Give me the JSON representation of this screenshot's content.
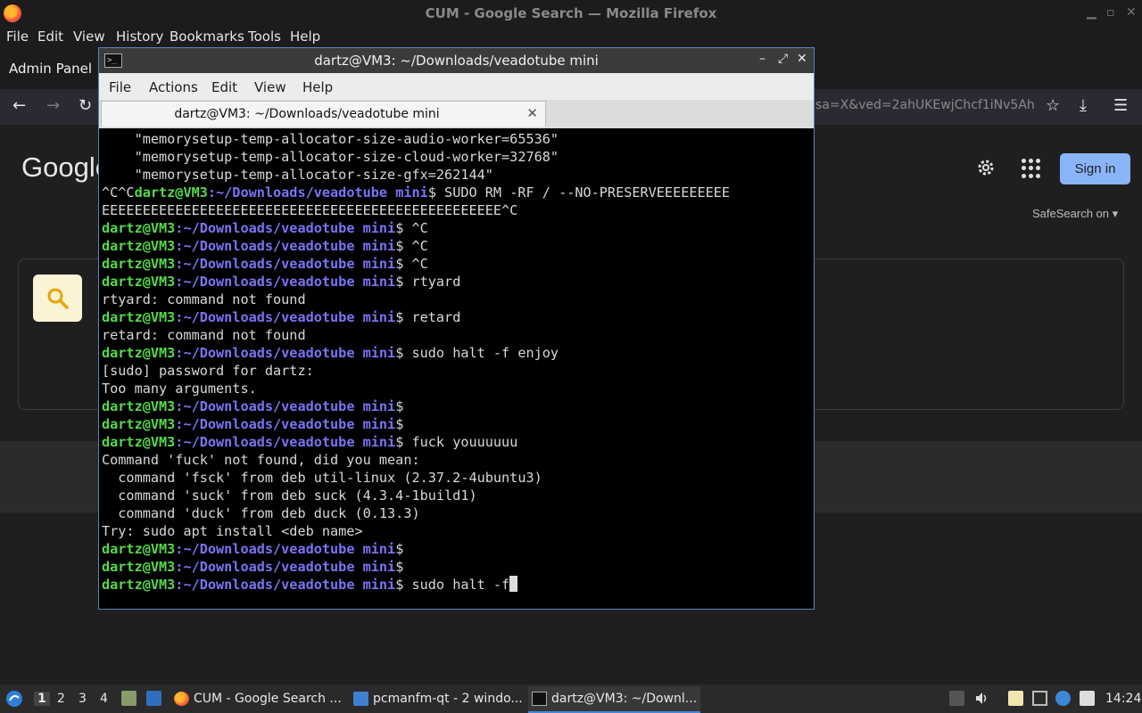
{
  "firefox": {
    "window_title": "CUM - Google Search — Mozilla Firefox",
    "menu": [
      "File",
      "Edit",
      "View",
      "History",
      "Bookmarks",
      "Tools",
      "Help"
    ],
    "bookmark_label": "Admin Panel",
    "url_fragment": "sa=X&ved=2ahUKEwjChcf1iNv5Ah"
  },
  "google": {
    "logo": "Google",
    "sign_in": "Sign in",
    "safesearch": "SafeSearch on ▾",
    "accent": "#8ab4f8"
  },
  "terminal": {
    "title": "dartz@VM3: ~/Downloads/veadotube mini",
    "menu": [
      "File",
      "Actions",
      "Edit",
      "View",
      "Help"
    ],
    "tab_title": "dartz@VM3: ~/Downloads/veadotube mini",
    "prompt_user": "dartz@VM3",
    "prompt_path": ":~/Downloads/veadotube ",
    "prompt_path2": "mini",
    "lines": [
      "    \"memorysetup-temp-allocator-size-audio-worker=65536\"",
      "    \"memorysetup-temp-allocator-size-cloud-worker=32768\"",
      "    \"memorysetup-temp-allocator-size-gfx=262144\"",
      "^C^C",
      "$ SUDO RM -RF / --NO-PRESERVEEEEEEEEE",
      "EEEEEEEEEEEEEEEEEEEEEEEEEEEEEEEEEEEEEEEEEEEEEEEEE^C",
      "$ ^C",
      "$ ^C",
      "$ ^C",
      "$ rtyard",
      "rtyard: command not found",
      "$ retard",
      "retard: command not found",
      "$ sudo halt -f enjoy",
      "[sudo] password for dartz:",
      "Too many arguments.",
      "$",
      "$",
      "$ fuck youuuuuu",
      "Command 'fuck' not found, did you mean:",
      "  command 'fsck' from deb util-linux (2.37.2-4ubuntu3)",
      "  command 'suck' from deb suck (4.3.4-1build1)",
      "  command 'duck' from deb duck (0.13.3)",
      "Try: sudo apt install <deb name>",
      "$",
      "$",
      "$ sudo halt -f"
    ]
  },
  "taskbar": {
    "workspaces": [
      "1",
      "2",
      "3",
      "4"
    ],
    "tasks": [
      "CUM - Google Search ...",
      "pcmanfm-qt - 2 windo...",
      "dartz@VM3: ~/Downl..."
    ],
    "clock": "14:24"
  }
}
